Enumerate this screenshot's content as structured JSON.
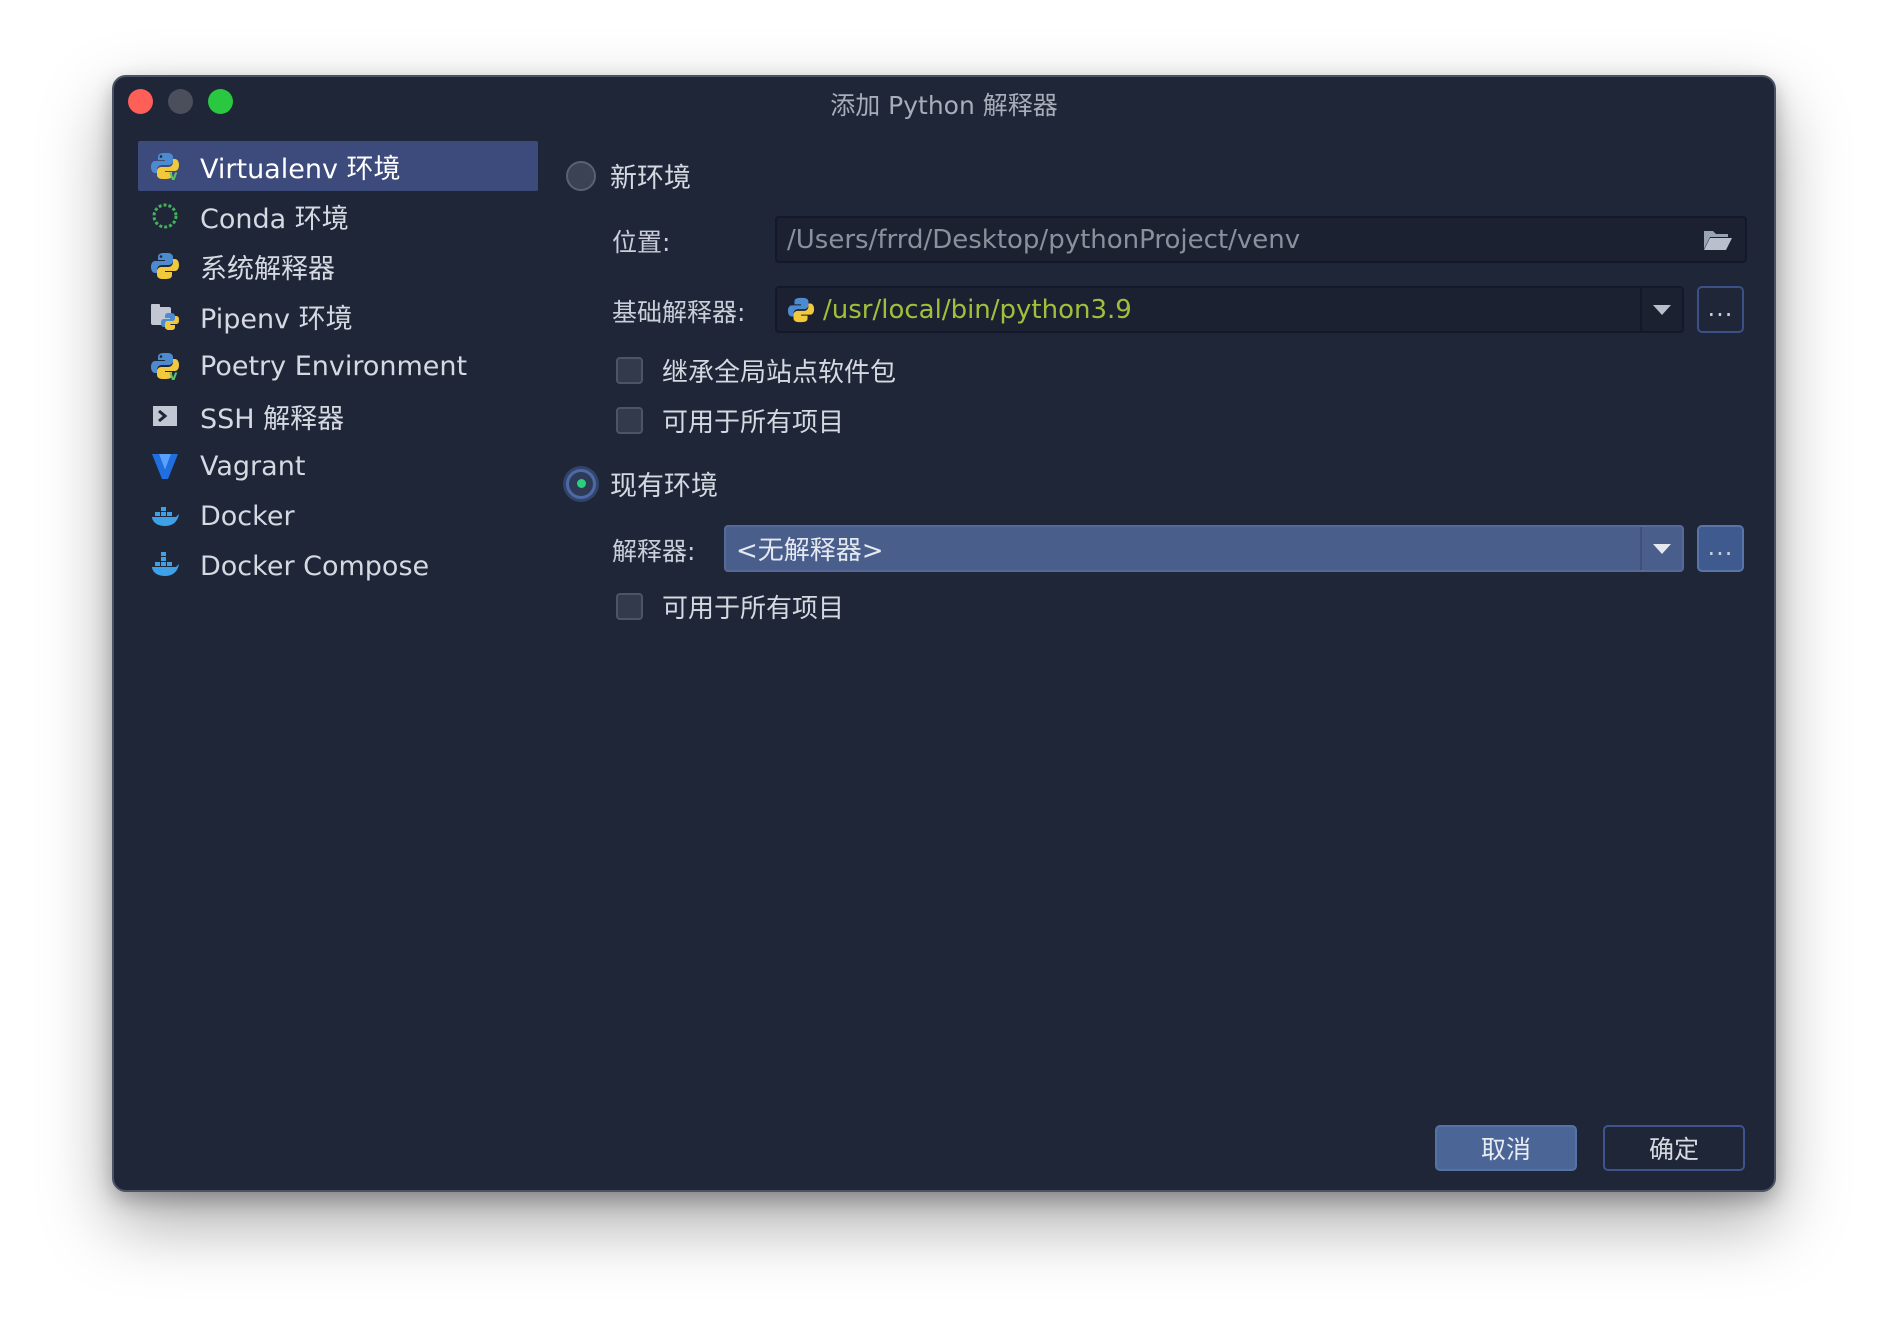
{
  "window": {
    "title": "添加 Python 解释器"
  },
  "sidebar": {
    "items": [
      {
        "label": "Virtualenv 环境",
        "icon": "python-virtualenv-icon",
        "selected": true
      },
      {
        "label": "Conda 环境",
        "icon": "conda-icon"
      },
      {
        "label": "系统解释器",
        "icon": "python-icon"
      },
      {
        "label": "Pipenv 环境",
        "icon": "pipenv-icon"
      },
      {
        "label": "Poetry Environment",
        "icon": "poetry-icon"
      },
      {
        "label": "SSH 解释器",
        "icon": "terminal-icon"
      },
      {
        "label": "Vagrant",
        "icon": "vagrant-icon"
      },
      {
        "label": "Docker",
        "icon": "docker-icon"
      },
      {
        "label": "Docker Compose",
        "icon": "docker-compose-icon"
      }
    ]
  },
  "new_env": {
    "radio_label": "新环境",
    "location_label": "位置:",
    "location_value": "/Users/frrd/Desktop/pythonProject/venv",
    "base_interpreter_label": "基础解释器:",
    "base_interpreter_value": "/usr/local/bin/python3.9",
    "browse_label": "...",
    "inherit_label": "继承全局站点软件包",
    "available_all_label": "可用于所有项目"
  },
  "existing_env": {
    "radio_label": "现有环境",
    "interpreter_label": "解释器:",
    "interpreter_value": "<无解释器>",
    "browse_label": "...",
    "available_all_label": "可用于所有项目"
  },
  "buttons": {
    "cancel": "取消",
    "ok": "确定"
  },
  "colors": {
    "window_bg": "#1e2638",
    "selection": "#3c4a7c",
    "accent_green": "#29d17c",
    "path_green": "#a0c03c",
    "button_blue": "#4b6597"
  }
}
